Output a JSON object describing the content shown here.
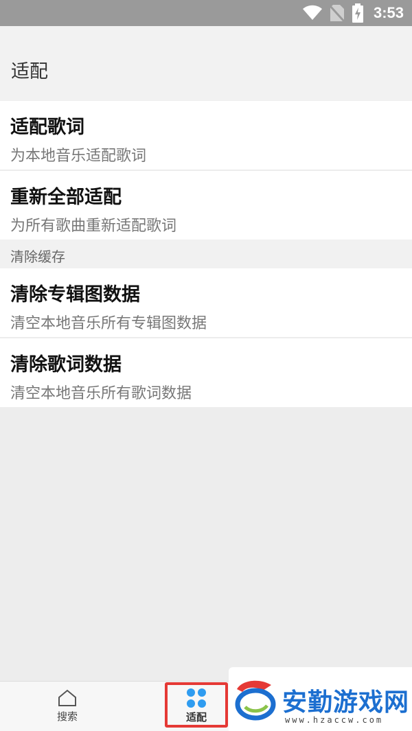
{
  "status_bar": {
    "time": "3:53",
    "icons": [
      "wifi-icon",
      "no-sim-icon",
      "battery-charging-icon"
    ]
  },
  "header": {
    "title": "适配"
  },
  "items": [
    {
      "title": "适配歌词",
      "subtitle": "为本地音乐适配歌词"
    },
    {
      "title": "重新全部适配",
      "subtitle": "为所有歌曲重新适配歌词"
    },
    {
      "title": "清除专辑图数据",
      "subtitle": "清空本地音乐所有专辑图数据"
    },
    {
      "title": "清除歌词数据",
      "subtitle": "清空本地音乐所有歌词数据"
    }
  ],
  "sections": {
    "cache_header": "清除缓存"
  },
  "bottom_nav": {
    "search_label": "搜索",
    "adapt_label": "适配",
    "active": "adapt",
    "accent_color": "#2f9cf0",
    "highlight_color": "#e53935"
  },
  "watermark": {
    "text": "安勤游戏网",
    "url": "www.hzaccw.com"
  }
}
